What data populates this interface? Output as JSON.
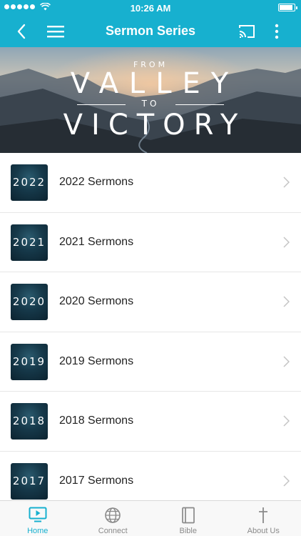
{
  "status_bar": {
    "time": "10:26 AM",
    "signal_bars": 5,
    "battery_level": 0.95
  },
  "header": {
    "title": "Sermon Series",
    "back_icon": "chevron-left-icon",
    "menu_icon": "hamburger-menu-icon",
    "cast_icon": "cast-icon",
    "more_icon": "more-vertical-icon"
  },
  "banner": {
    "line1": "FROM",
    "line2": "VALLEY",
    "line3": "TO",
    "line4": "VICTORY"
  },
  "series": [
    {
      "year": "2022",
      "label": "2022 Sermons"
    },
    {
      "year": "2021",
      "label": "2021 Sermons"
    },
    {
      "year": "2020",
      "label": "2020 Sermons"
    },
    {
      "year": "2019",
      "label": "2019 Sermons"
    },
    {
      "year": "2018",
      "label": "2018 Sermons"
    },
    {
      "year": "2017",
      "label": "2017 Sermons"
    }
  ],
  "tabs": [
    {
      "label": "Home",
      "icon": "tv-play-icon",
      "active": true
    },
    {
      "label": "Connect",
      "icon": "globe-icon",
      "active": false
    },
    {
      "label": "Bible",
      "icon": "book-icon",
      "active": false
    },
    {
      "label": "About Us",
      "icon": "cross-icon",
      "active": false
    }
  ],
  "colors": {
    "accent": "#17b0cf",
    "tab_inactive": "#8a8a8a"
  }
}
